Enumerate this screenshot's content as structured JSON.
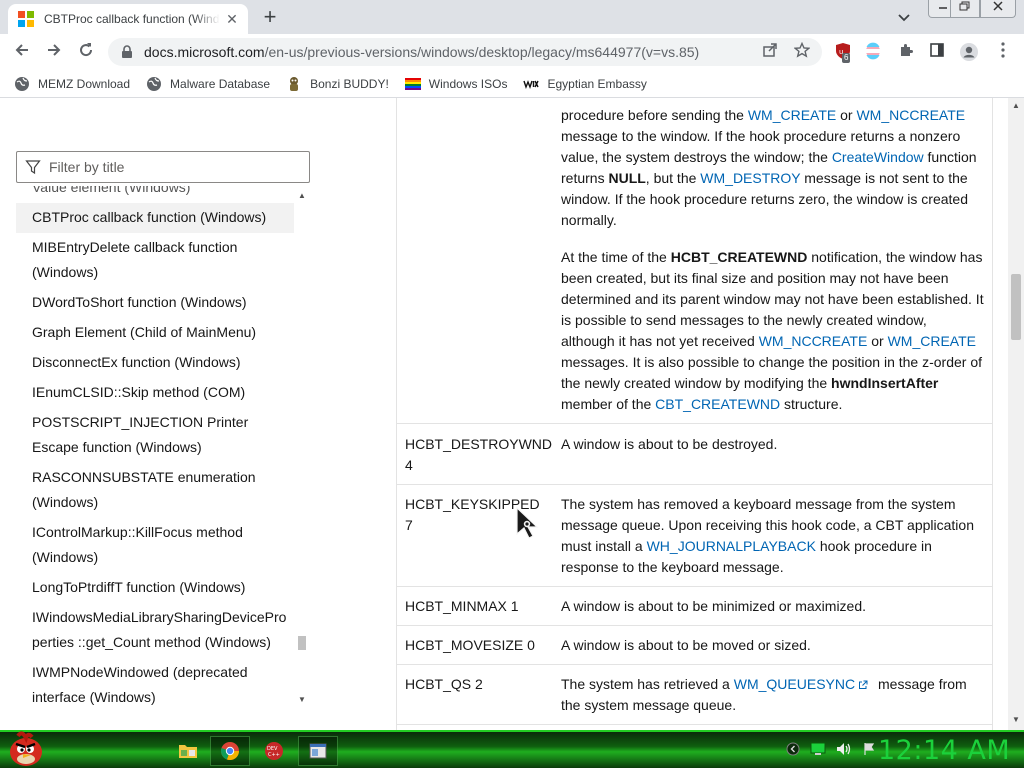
{
  "browser": {
    "tab_title": "CBTProc callback function (Windows)",
    "new_tab_symbol": "+",
    "url_domain": "docs.microsoft.com",
    "url_path": "/en-us/previous-versions/windows/desktop/legacy/ms644977(v=vs.85)",
    "extension_badge": "6"
  },
  "bookmarks": [
    {
      "label": "MEMZ Download",
      "icon": "globe-icon"
    },
    {
      "label": "Malware Database",
      "icon": "globe-icon"
    },
    {
      "label": "Bonzi BUDDY!",
      "icon": "bonzi-icon"
    },
    {
      "label": "Windows ISOs",
      "icon": "rainbow-flag-icon"
    },
    {
      "label": "Egyptian Embassy",
      "icon": "wix-icon"
    }
  ],
  "sidebar": {
    "filter_placeholder": "Filter by title",
    "items": [
      "Value element (Windows)",
      "CBTProc callback function (Windows)",
      "MIBEntryDelete callback function (Windows)",
      "DWordToShort function (Windows)",
      "Graph Element (Child of MainMenu)",
      "DisconnectEx function (Windows)",
      "IEnumCLSID::Skip method (COM)",
      "POSTSCRIPT_INJECTION Printer Escape function (Windows)",
      "RASCONNSUBSTATE enumeration (Windows)",
      "IControlMarkup::KillFocus method (Windows)",
      "LongToPtrdiffT function (Windows)",
      "IWindowsMediaLibrarySharingDeviceProperties ::get_Count method (Windows)",
      "IWMPNodeWindowed (deprecated interface (Windows)"
    ]
  },
  "content": {
    "createwnd_p1": {
      "t1": "procedure before sending the ",
      "l1": "WM_CREATE",
      "t2": " or ",
      "l2": "WM_NCCREATE",
      "t3": " message to the window. If the hook procedure returns a nonzero value, the system destroys the window; the ",
      "l3": "CreateWindow",
      "t4": " function returns ",
      "b1": "NULL",
      "t5": ", but the ",
      "l4": "WM_DESTROY",
      "t6": " message is not sent to the window. If the hook procedure returns zero, the window is created normally."
    },
    "createwnd_p2": {
      "t1": "At the time of the ",
      "b1": "HCBT_CREATEWND",
      "t2": " notification, the window has been created, but its final size and position may not have been determined and its parent window may not have been established. It is possible to send messages to the newly created window, although it has not yet received ",
      "l1": "WM_NCCREATE",
      "t3": " or ",
      "l2": "WM_CREATE",
      "t4": " messages. It is also possible to change the position in the z-order of the newly created window by modifying the ",
      "b2": "hwndInsertAfter",
      "t5": " member of the ",
      "l3": "CBT_CREATEWND",
      "t6": " structure."
    },
    "rows": {
      "destroywnd": {
        "name": "HCBT_DESTROYWND",
        "value": "4",
        "desc": "A window is about to be destroyed."
      },
      "keyskipped": {
        "name": "HCBT_KEYSKIPPED",
        "value": "7",
        "t1": "The system has removed a keyboard message from the system message queue. Upon receiving this hook code, a CBT application must install a ",
        "l1": "WH_JOURNALPLAYBACK",
        "t2": " hook procedure in response to the keyboard message."
      },
      "minmax": {
        "name": "HCBT_MINMAX",
        "value": "1",
        "desc": "A window is about to be minimized or maximized."
      },
      "movesize": {
        "name": "HCBT_MOVESIZE",
        "value": "0",
        "desc": "A window is about to be moved or sized."
      },
      "qs": {
        "name": "HCBT_QS",
        "value": "2",
        "t1": "The system has retrieved a ",
        "l1": "WM_QUEUESYNC",
        "t2": " message from the system message queue."
      }
    }
  },
  "taskbar": {
    "clock": "12:14 AM",
    "accent_color": "#1bd13b"
  }
}
